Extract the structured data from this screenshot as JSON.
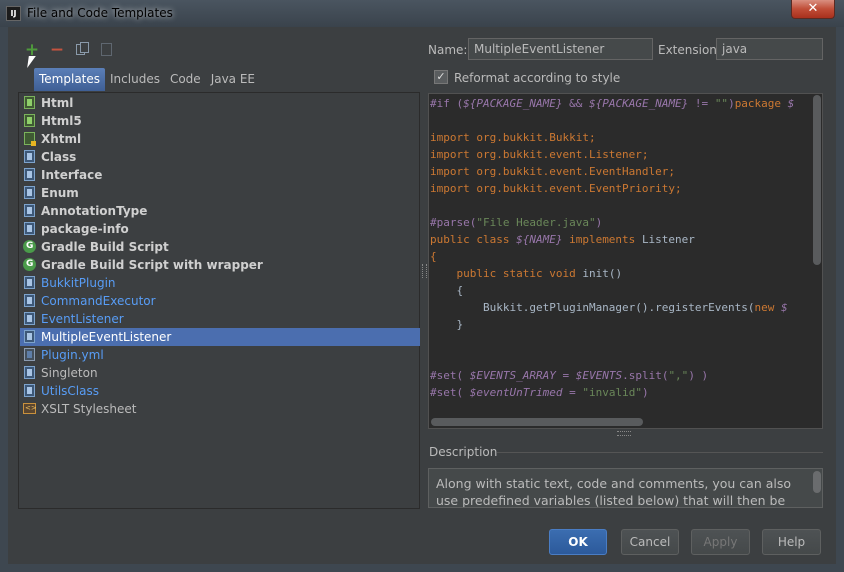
{
  "window": {
    "title": "File and Code Templates",
    "close_glyph": "✕"
  },
  "toolbar": {
    "add_glyph": "+",
    "remove_glyph": "−"
  },
  "tabs": [
    "Templates",
    "Includes",
    "Code",
    "Java EE"
  ],
  "templates": [
    {
      "label": "Html",
      "icon": "html-file-icon",
      "style": "bold"
    },
    {
      "label": "Html5",
      "icon": "html-file-icon",
      "style": "bold"
    },
    {
      "label": "Xhtml",
      "icon": "xhtml-file-icon",
      "style": "bold"
    },
    {
      "label": "Class",
      "icon": "java-file-icon",
      "style": "bold"
    },
    {
      "label": "Interface",
      "icon": "java-file-icon",
      "style": "bold"
    },
    {
      "label": "Enum",
      "icon": "java-file-icon",
      "style": "bold"
    },
    {
      "label": "AnnotationType",
      "icon": "java-file-icon",
      "style": "bold"
    },
    {
      "label": "package-info",
      "icon": "java-file-icon",
      "style": "bold"
    },
    {
      "label": "Gradle Build Script",
      "icon": "gradle-icon",
      "style": "bold"
    },
    {
      "label": "Gradle Build Script with wrapper",
      "icon": "gradle-icon",
      "style": "bold"
    },
    {
      "label": "BukkitPlugin",
      "icon": "java-file-icon",
      "style": "link"
    },
    {
      "label": "CommandExecutor",
      "icon": "java-file-icon",
      "style": "link"
    },
    {
      "label": "EventListener",
      "icon": "java-file-icon",
      "style": "link"
    },
    {
      "label": "MultipleEventListener",
      "icon": "java-file-icon",
      "style": "selected"
    },
    {
      "label": "Plugin.yml",
      "icon": "file-icon",
      "style": "link"
    },
    {
      "label": "Singleton",
      "icon": "java-file-icon",
      "style": "plain"
    },
    {
      "label": "UtilsClass",
      "icon": "java-file-icon",
      "style": "link"
    },
    {
      "label": "XSLT Stylesheet",
      "icon": "xslt-file-icon",
      "style": "plain"
    }
  ],
  "form": {
    "name_label": "Name:",
    "name_value": "MultipleEventListener",
    "extension_label": "Extension:",
    "extension_value": "java",
    "reformat_label": "Reformat according to style",
    "reformat_checked": true,
    "check_glyph": "✓"
  },
  "code_lines": [
    [
      [
        "dir",
        "#if ("
      ],
      [
        "var",
        "${PACKAGE_NAME}"
      ],
      [
        "dir",
        " && "
      ],
      [
        "var",
        "${PACKAGE_NAME}"
      ],
      [
        "dir",
        " != "
      ],
      [
        "str",
        "\"\""
      ],
      [
        "dir",
        ")"
      ],
      [
        "kw",
        "package "
      ],
      [
        "var",
        "$"
      ]
    ],
    [],
    [
      [
        "kw",
        "import "
      ],
      [
        "kw",
        "org.bukkit.Bukkit;"
      ]
    ],
    [
      [
        "kw",
        "import "
      ],
      [
        "kw",
        "org.bukkit.event.Listener;"
      ]
    ],
    [
      [
        "kw",
        "import "
      ],
      [
        "kw",
        "org.bukkit.event.EventHandler;"
      ]
    ],
    [
      [
        "kw",
        "import "
      ],
      [
        "kw",
        "org.bukkit.event.EventPriority;"
      ]
    ],
    [],
    [
      [
        "dir",
        "#parse("
      ],
      [
        "str",
        "\"File Header.java\""
      ],
      [
        "dir",
        ")"
      ]
    ],
    [
      [
        "kw",
        "public class "
      ],
      [
        "var",
        "${NAME}"
      ],
      [
        "kw",
        " implements "
      ],
      [
        "txt",
        "Listener"
      ]
    ],
    [
      [
        "kw",
        "{"
      ]
    ],
    [
      [
        "txt",
        "    "
      ],
      [
        "kw",
        "public static void "
      ],
      [
        "txt",
        "init()"
      ]
    ],
    [
      [
        "txt",
        "    {"
      ]
    ],
    [
      [
        "txt",
        "        Bukkit.getPluginManager().registerEvents("
      ],
      [
        "kw",
        "new "
      ],
      [
        "var",
        "$"
      ]
    ],
    [
      [
        "txt",
        "    }"
      ]
    ],
    [],
    [],
    [
      [
        "dir",
        "#set( "
      ],
      [
        "var",
        "$EVENTS_ARRAY"
      ],
      [
        "dir",
        " = "
      ],
      [
        "var",
        "$EVENTS"
      ],
      [
        "dir",
        ".split("
      ],
      [
        "str",
        "\",\""
      ],
      [
        "dir",
        ") )"
      ]
    ],
    [
      [
        "dir",
        "#set( "
      ],
      [
        "var",
        "$eventUnTrimed"
      ],
      [
        "dir",
        " = "
      ],
      [
        "str",
        "\"invalid\""
      ],
      [
        "dir",
        ")"
      ]
    ]
  ],
  "description": {
    "title": "Description",
    "text": "Along with static text, code and comments, you can also use predefined variables (listed below) that will then be"
  },
  "buttons": {
    "ok": "OK",
    "cancel": "Cancel",
    "apply": "Apply",
    "help": "Help"
  }
}
